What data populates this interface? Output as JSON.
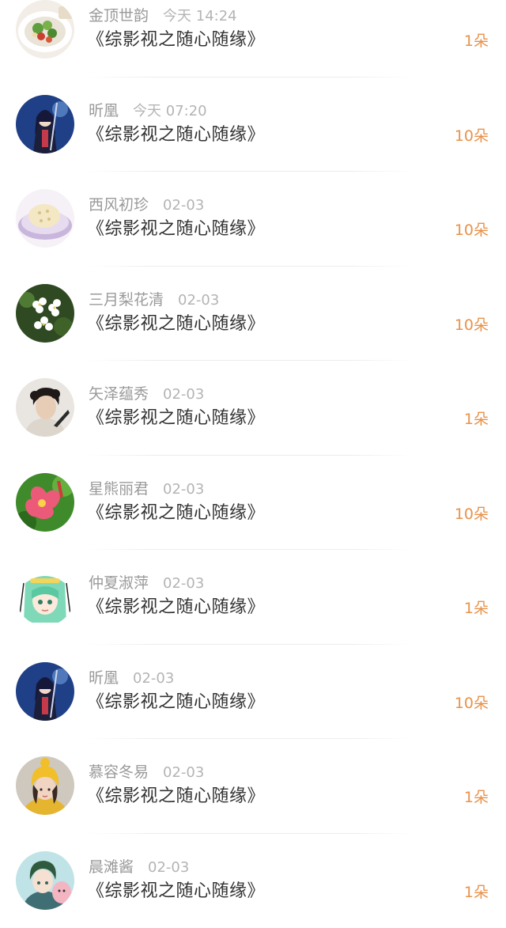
{
  "comments": [
    {
      "user": "金顶世韵",
      "time": "今天 14:24",
      "text": "《综影视之随心随缘》",
      "gift": "1朵",
      "avatar_icon": "salad-dish-avatar"
    },
    {
      "user": "昕凰",
      "time": "今天 07:20",
      "text": "《综影视之随心随缘》",
      "gift": "10朵",
      "avatar_icon": "anime-swordswoman-avatar"
    },
    {
      "user": "西风初珍",
      "time": "02-03",
      "text": "《综影视之随心随缘》",
      "gift": "10朵",
      "avatar_icon": "cake-plate-avatar"
    },
    {
      "user": "三月梨花清",
      "time": "02-03",
      "text": "《综影视之随心随缘》",
      "gift": "10朵",
      "avatar_icon": "white-blossoms-avatar"
    },
    {
      "user": "矢泽蕴秀",
      "time": "02-03",
      "text": "《综影视之随心随缘》",
      "gift": "1朵",
      "avatar_icon": "curly-hair-man-avatar"
    },
    {
      "user": "星熊丽君",
      "time": "02-03",
      "text": "《综影视之随心随缘》",
      "gift": "10朵",
      "avatar_icon": "pink-flower-avatar"
    },
    {
      "user": "仲夏淑萍",
      "time": "02-03",
      "text": "《综影视之随心随缘》",
      "gift": "1朵",
      "avatar_icon": "anime-green-hair-avatar"
    },
    {
      "user": "昕凰",
      "time": "02-03",
      "text": "《综影视之随心随缘》",
      "gift": "10朵",
      "avatar_icon": "anime-swordswoman-avatar"
    },
    {
      "user": "慕容冬易",
      "time": "02-03",
      "text": "《综影视之随心随缘》",
      "gift": "1朵",
      "avatar_icon": "girl-yellow-hat-avatar"
    },
    {
      "user": "晨滩酱",
      "time": "02-03",
      "text": "《综影视之随心随缘》",
      "gift": "1朵",
      "avatar_icon": "anime-boy-avatar"
    }
  ],
  "colors": {
    "gift_accent": "#e8924a",
    "username": "#9a9a9a",
    "timestamp": "#b4b4b4",
    "comment_text": "#333333"
  }
}
